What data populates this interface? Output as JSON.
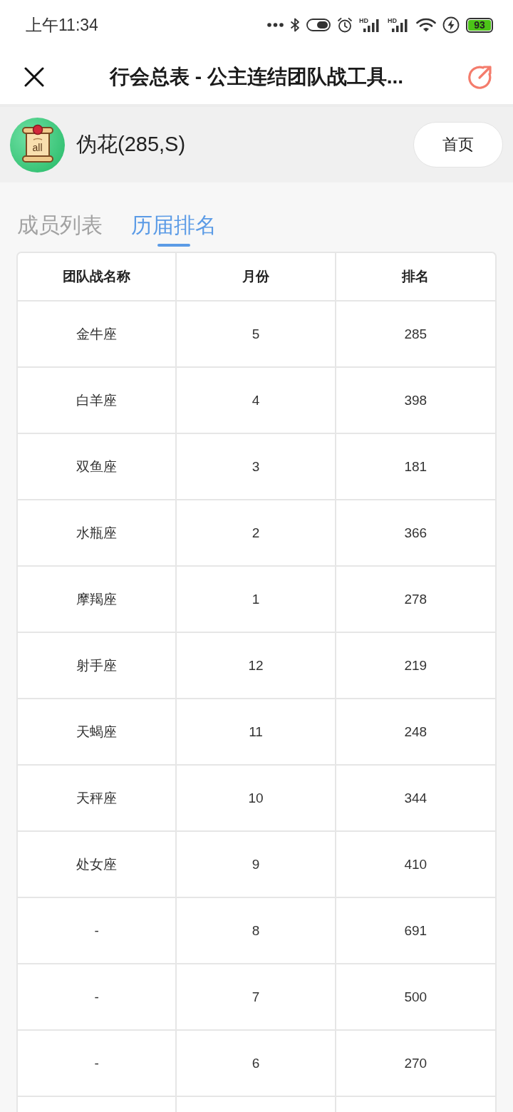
{
  "status_bar": {
    "time": "上午11:34",
    "network_labels": [
      "HD",
      "HD"
    ],
    "battery": "93"
  },
  "header": {
    "title": "行会总表 - 公主连结团队战工具..."
  },
  "profile": {
    "avatar_label": "all",
    "name": "伪花(285,S)",
    "home_button": "首页"
  },
  "tabs": [
    {
      "label": "成员列表",
      "selected": false
    },
    {
      "label": "历届排名",
      "selected": true
    }
  ],
  "table": {
    "columns": [
      "团队战名称",
      "月份",
      "排名"
    ],
    "rows": [
      [
        "金牛座",
        "5",
        "285"
      ],
      [
        "白羊座",
        "4",
        "398"
      ],
      [
        "双鱼座",
        "3",
        "181"
      ],
      [
        "水瓶座",
        "2",
        "366"
      ],
      [
        "摩羯座",
        "1",
        "278"
      ],
      [
        "射手座",
        "12",
        "219"
      ],
      [
        "天蝎座",
        "11",
        "248"
      ],
      [
        "天秤座",
        "10",
        "344"
      ],
      [
        "处女座",
        "9",
        "410"
      ],
      [
        "-",
        "8",
        "691"
      ],
      [
        "-",
        "7",
        "500"
      ],
      [
        "-",
        "6",
        "270"
      ]
    ]
  }
}
